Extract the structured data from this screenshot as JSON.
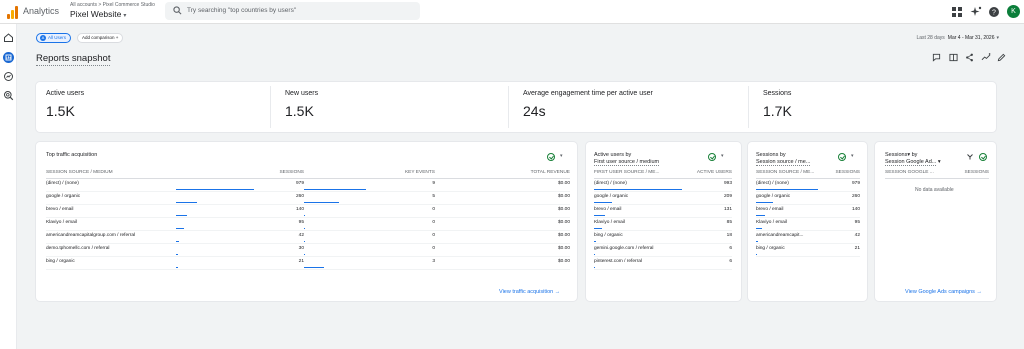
{
  "app": {
    "title": "Analytics",
    "breadcrumb": "All accounts > Pixel Commerce Studio",
    "property": "Pixel Website"
  },
  "search": {
    "placeholder": "Try searching \"top countries by users\""
  },
  "user": {
    "avatar_letter": "K"
  },
  "filters": {
    "all_users": "All Users",
    "all_users_badge": "A",
    "add_comparison": "Add comparison"
  },
  "date": {
    "label": "Last 28 days",
    "range": "Mar 4 - Mar 31, 2026"
  },
  "page": {
    "title": "Reports snapshot"
  },
  "metrics": [
    {
      "label": "Active users",
      "value": "1.5K"
    },
    {
      "label": "New users",
      "value": "1.5K"
    },
    {
      "label": "Average engagement time per active user",
      "value": "24s"
    },
    {
      "label": "Sessions",
      "value": "1.7K"
    }
  ],
  "traffic": {
    "title": "Top traffic acquisition",
    "headers": [
      "SESSION SOURCE / MEDIUM",
      "SESSIONS",
      "KEY EVENTS",
      "TOTAL REVENUE"
    ],
    "rows": [
      {
        "source": "(direct) / (none)",
        "sessions": "979",
        "key_events": "9",
        "revenue": "$0.00",
        "s_frac": 1.0,
        "k_frac": 1.0
      },
      {
        "source": "google / organic",
        "sessions": "260",
        "key_events": "5",
        "revenue": "$0.00",
        "s_frac": 0.27,
        "k_frac": 0.56
      },
      {
        "source": "brevo / email",
        "sessions": "140",
        "key_events": "0",
        "revenue": "$0.00",
        "s_frac": 0.14,
        "k_frac": 0
      },
      {
        "source": "Klaviyo / email",
        "sessions": "95",
        "key_events": "0",
        "revenue": "$0.00",
        "s_frac": 0.1,
        "k_frac": 0
      },
      {
        "source": "americandreamcapitalgroup.com / referral",
        "sessions": "42",
        "key_events": "0",
        "revenue": "$0.00",
        "s_frac": 0.04,
        "k_frac": 0
      },
      {
        "source": "demo.tphomellc.com / referral",
        "sessions": "30",
        "key_events": "0",
        "revenue": "$0.00",
        "s_frac": 0.03,
        "k_frac": 0
      },
      {
        "source": "bing / organic",
        "sessions": "21",
        "key_events": "3",
        "revenue": "$0.00",
        "s_frac": 0.02,
        "k_frac": 0.33
      }
    ],
    "link": "View traffic acquisition"
  },
  "active_by_source": {
    "title_line1": "Active users by",
    "title_line2": "First user source / medium",
    "headers": [
      "FIRST USER SOURCE / ME...",
      "ACTIVE USERS"
    ],
    "rows": [
      {
        "source": "(direct) / (none)",
        "value": "993",
        "frac": 1.0
      },
      {
        "source": "google / organic",
        "value": "209",
        "frac": 0.21
      },
      {
        "source": "brevo / email",
        "value": "131",
        "frac": 0.13
      },
      {
        "source": "Klaviyo / email",
        "value": "85",
        "frac": 0.09
      },
      {
        "source": "bing / organic",
        "value": "18",
        "frac": 0.02
      },
      {
        "source": "gemini.google.com / referral",
        "value": "6",
        "frac": 0.01
      },
      {
        "source": "pinterest.com / referral",
        "value": "6",
        "frac": 0.01
      }
    ]
  },
  "sessions_by_source": {
    "title_line1": "Sessions by",
    "title_line2": "Session source / me...",
    "headers": [
      "SESSION SOURCE / ME...",
      "SESSIONS"
    ],
    "rows": [
      {
        "source": "(direct) / (none)",
        "value": "979",
        "frac": 1.0
      },
      {
        "source": "google / organic",
        "value": "260",
        "frac": 0.27
      },
      {
        "source": "brevo / email",
        "value": "140",
        "frac": 0.14
      },
      {
        "source": "Klaviyo / email",
        "value": "95",
        "frac": 0.1
      },
      {
        "source": "americandreamcapit...",
        "value": "42",
        "frac": 0.04
      },
      {
        "source": "bing / organic",
        "value": "21",
        "frac": 0.02
      }
    ]
  },
  "sessions_ads": {
    "title_line1": "Sessions▾ by",
    "title_line2": "Session Google Ad...",
    "headers": [
      "SESSION GOOGLE ...",
      "SESSIONS"
    ],
    "no_data": "No data available",
    "link": "View Google Ads campaigns"
  },
  "colors": {
    "accent": "#1a73e8",
    "success": "#188038",
    "brand": "#f9ab00"
  }
}
